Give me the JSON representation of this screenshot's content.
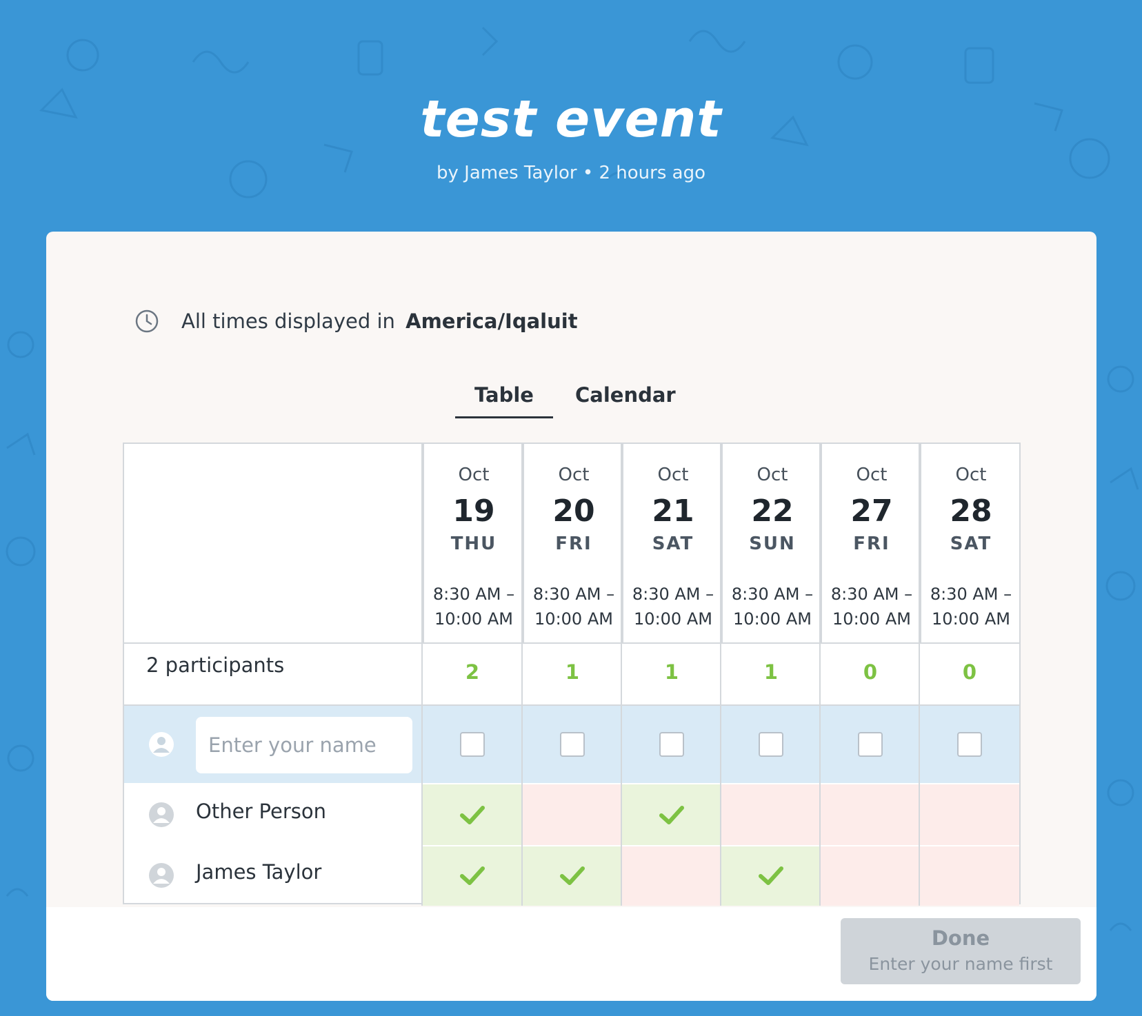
{
  "event": {
    "title": "test event",
    "subtitle": "by James Taylor • 2 hours ago"
  },
  "timezone": {
    "prefix": "All times displayed in",
    "zone": "America/Iqaluit",
    "icon": "clock-icon"
  },
  "tabs": [
    {
      "label": "Table",
      "active": true
    },
    {
      "label": "Calendar",
      "active": false
    }
  ],
  "columns": [
    {
      "month": "Oct",
      "day": "19",
      "dow": "THU",
      "time_start": "8:30 AM –",
      "time_end": "10:00 AM",
      "count": "2"
    },
    {
      "month": "Oct",
      "day": "20",
      "dow": "FRI",
      "time_start": "8:30 AM –",
      "time_end": "10:00 AM",
      "count": "1"
    },
    {
      "month": "Oct",
      "day": "21",
      "dow": "SAT",
      "time_start": "8:30 AM –",
      "time_end": "10:00 AM",
      "count": "1"
    },
    {
      "month": "Oct",
      "day": "22",
      "dow": "SUN",
      "time_start": "8:30 AM –",
      "time_end": "10:00 AM",
      "count": "1"
    },
    {
      "month": "Oct",
      "day": "27",
      "dow": "FRI",
      "time_start": "8:30 AM –",
      "time_end": "10:00 AM",
      "count": "0"
    },
    {
      "month": "Oct",
      "day": "28",
      "dow": "SAT",
      "time_start": "8:30 AM –",
      "time_end": "10:00 AM",
      "count": "0"
    }
  ],
  "participants_label": "2 participants",
  "name_input": {
    "placeholder": "Enter your name",
    "value": ""
  },
  "people": [
    {
      "name": "Other Person",
      "availability": [
        true,
        false,
        true,
        false,
        false,
        false
      ]
    },
    {
      "name": "James Taylor",
      "availability": [
        true,
        true,
        false,
        true,
        false,
        false
      ]
    }
  ],
  "done_button": {
    "label": "Done",
    "hint": "Enter your name first"
  },
  "colors": {
    "header_bg": "#3a96d6",
    "available": "#eaf4dc",
    "unavailable": "#fdecea",
    "check": "#7dc243",
    "input_row": "#d9eaf6"
  }
}
